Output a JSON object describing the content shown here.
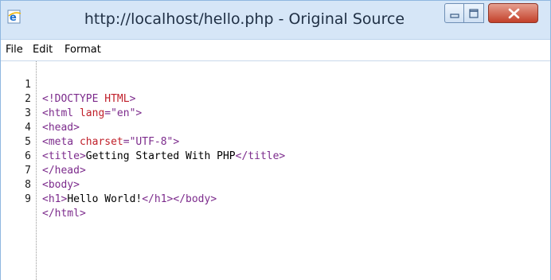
{
  "window": {
    "title": "http://localhost/hello.php - Original Source",
    "icon": "ie-e-icon",
    "controls": [
      "minimize-icon",
      "maximize-icon",
      "close-icon"
    ]
  },
  "menubar": {
    "items": [
      "File",
      "Edit",
      "Format"
    ]
  },
  "editor": {
    "lines": [
      {
        "num": "1",
        "a": "<!DOCTYPE",
        "b": " HTML",
        "c": ">"
      },
      {
        "num": "2",
        "a": "<html",
        "b": " lang",
        "c": "=\"en\">"
      },
      {
        "num": "3",
        "a": "<head>",
        "b": "",
        "c": ""
      },
      {
        "num": "4",
        "a": "<meta",
        "b": " charset",
        "c": "=\"UTF-8\">"
      },
      {
        "num": "5",
        "a": "<title>",
        "b": "Getting Started With PHP",
        "c": "</title>"
      },
      {
        "num": "6",
        "a": "</head>",
        "b": "",
        "c": ""
      },
      {
        "num": "7",
        "a": "<body>",
        "b": "",
        "c": ""
      },
      {
        "num": "8",
        "a": "<h1>",
        "b": "Hello World!",
        "c": "</h1></body>"
      },
      {
        "num": "9",
        "a": "</html>",
        "b": "",
        "c": ""
      }
    ]
  }
}
